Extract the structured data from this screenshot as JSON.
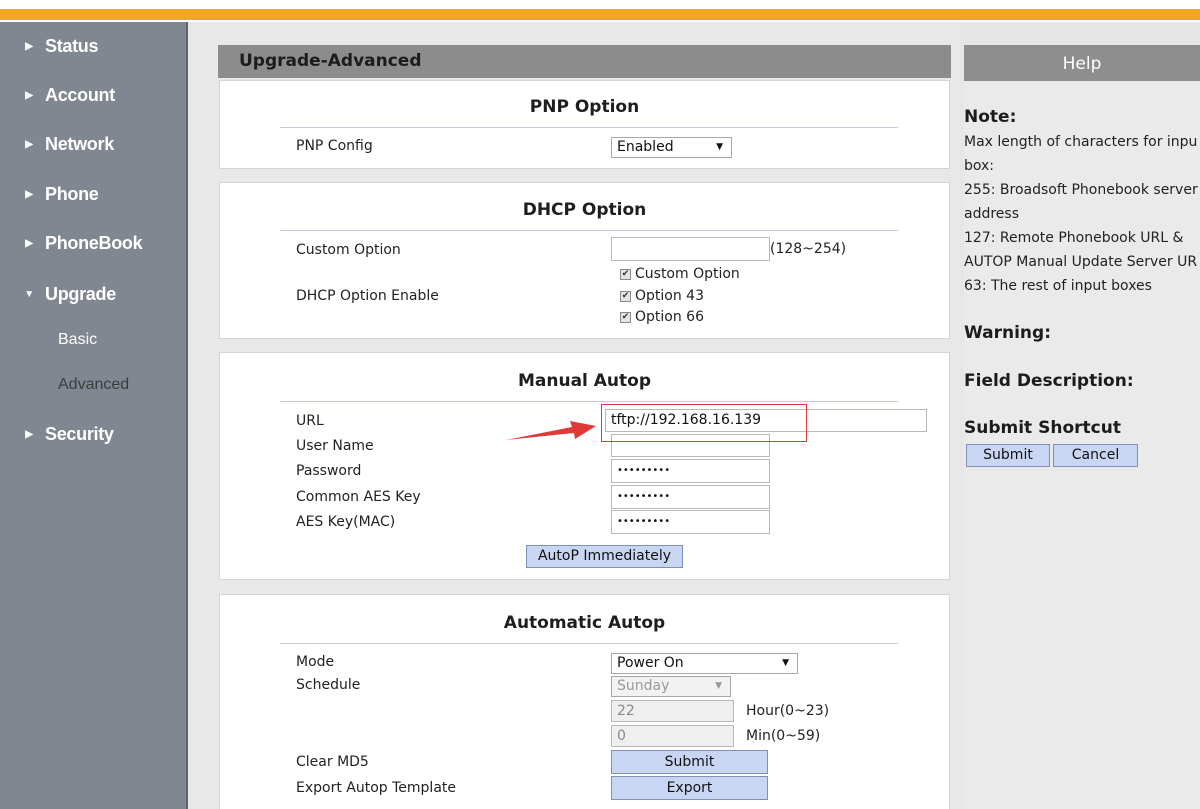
{
  "sidebar": {
    "items": [
      {
        "label": "Status"
      },
      {
        "label": "Account"
      },
      {
        "label": "Network"
      },
      {
        "label": "Phone"
      },
      {
        "label": "PhoneBook"
      },
      {
        "label": "Upgrade"
      },
      {
        "label": "Security"
      }
    ],
    "subitems": [
      {
        "label": "Basic"
      },
      {
        "label": "Advanced"
      }
    ]
  },
  "panel": {
    "title": "Upgrade-Advanced",
    "pnp": {
      "title": "PNP Option",
      "config_label": "PNP Config",
      "config_value": "Enabled"
    },
    "dhcp": {
      "title": "DHCP Option",
      "custom_label": "Custom Option",
      "custom_value": "",
      "custom_range": "(128~254)",
      "enable_label": "DHCP Option Enable",
      "options": [
        {
          "label": "Custom Option",
          "checked": true
        },
        {
          "label": "Option 43",
          "checked": true
        },
        {
          "label": "Option 66",
          "checked": true
        }
      ]
    },
    "manual": {
      "title": "Manual Autop",
      "url_label": "URL",
      "url_value": "tftp://192.168.16.139",
      "user_label": "User Name",
      "user_value": "",
      "password_label": "Password",
      "password_value": "•••••••••",
      "common_aes_label": "Common AES Key",
      "common_aes_value": "•••••••••",
      "aes_mac_label": "AES Key(MAC)",
      "aes_mac_value": "•••••••••",
      "autop_button": "AutoP Immediately"
    },
    "automatic": {
      "title": "Automatic Autop",
      "mode_label": "Mode",
      "mode_value": "Power On",
      "schedule_label": "Schedule",
      "schedule_value": "Sunday",
      "hour_value": "22",
      "hour_label": "Hour(0~23)",
      "min_value": "0",
      "min_label": "Min(0~59)",
      "clear_md5_label": "Clear MD5",
      "submit_button": "Submit",
      "export_label": "Export Autop Template",
      "export_button": "Export"
    }
  },
  "help": {
    "title": "Help",
    "note_title": "Note:",
    "note_lines": [
      "Max length of characters for inpu",
      "box:",
      "255: Broadsoft Phonebook server",
      "address",
      "127: Remote Phonebook URL &",
      "AUTOP Manual Update Server UR",
      "63: The rest of input boxes"
    ],
    "warning_title": "Warning:",
    "field_desc_title": "Field Description:",
    "shortcut_title": "Submit Shortcut",
    "submit_button": "Submit",
    "cancel_button": "Cancel"
  },
  "colors": {
    "accent_stripe": "#f0a820",
    "sidebar_bg": "#818791",
    "annotation_red": "#e0393a"
  }
}
